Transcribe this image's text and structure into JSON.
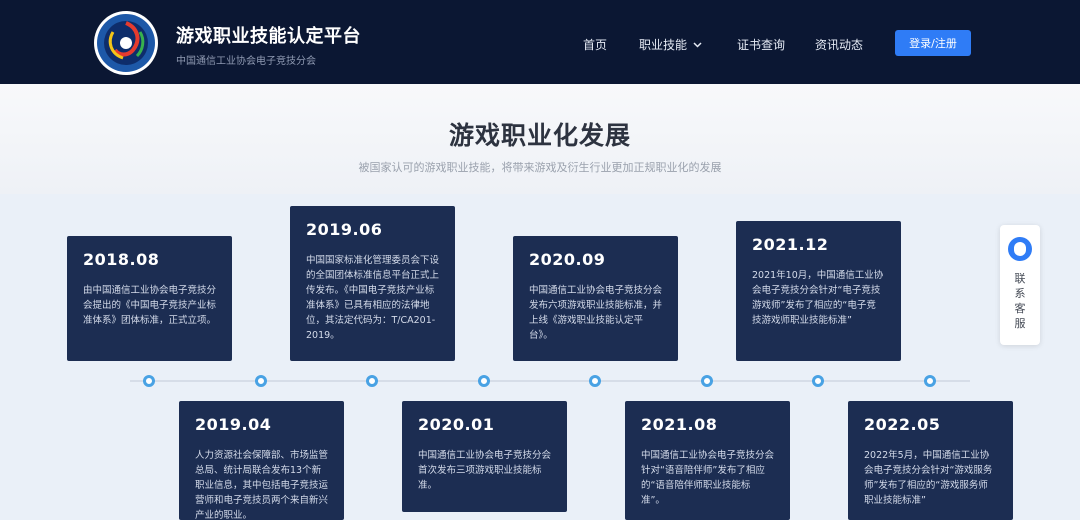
{
  "header": {
    "title": "游戏职业技能认定平台",
    "subtitle": "中国通信工业协会电子竞技分会",
    "nav": [
      {
        "label": "首页"
      },
      {
        "label": "职业技能"
      },
      {
        "label": "证书查询"
      },
      {
        "label": "资讯动态"
      }
    ],
    "login_label": "登录/注册"
  },
  "section": {
    "title": "游戏职业化发展",
    "subtitle": "被国家认可的游戏职业技能，将带来游戏及衍生行业更加正规职业化的发展"
  },
  "timeline": [
    {
      "year": "2018.08",
      "text": "由中国通信工业协会电子竞技分会提出的《中国电子竞技产业标准体系》团体标准，正式立项。"
    },
    {
      "year": "2019.04",
      "text": "人力资源社会保障部、市场监管总局、统计局联合发布13个新职业信息，其中包括电子竞技运营师和电子竞技员两个来自新兴产业的职业。"
    },
    {
      "year": "2019.06",
      "text": "中国国家标准化管理委员会下设的全国团体标准信息平台正式上传发布。《中国电子竞技产业标准体系》已具有相应的法律地位，其法定代码为：T/CA201-2019。"
    },
    {
      "year": "2020.01",
      "text": "中国通信工业协会电子竞技分会首次发布三项游戏职业技能标准。"
    },
    {
      "year": "2020.09",
      "text": "中国通信工业协会电子竞技分会发布六项游戏职业技能标准，并上线《游戏职业技能认定平台》。"
    },
    {
      "year": "2021.08",
      "text": "中国通信工业协会电子竞技分会针对“语音陪伴师”发布了相应的“语音陪伴师职业技能标准”。"
    },
    {
      "year": "2021.12",
      "text": "2021年10月，中国通信工业协会电子竞技分会针对“电子竞技游戏师”发布了相应的“电子竞技游戏师职业技能标准”"
    },
    {
      "year": "2022.05",
      "text": "2022年5月，中国通信工业协会电子竞技分会针对“游戏服务师”发布了相应的“游戏服务师职业技能标准”"
    }
  ],
  "side_widget": {
    "label": "联系客服"
  },
  "colors": {
    "navbar": "#0b1733",
    "card": "#1c2d52",
    "accent": "#2f7cf6",
    "dot": "#49a2e4"
  }
}
